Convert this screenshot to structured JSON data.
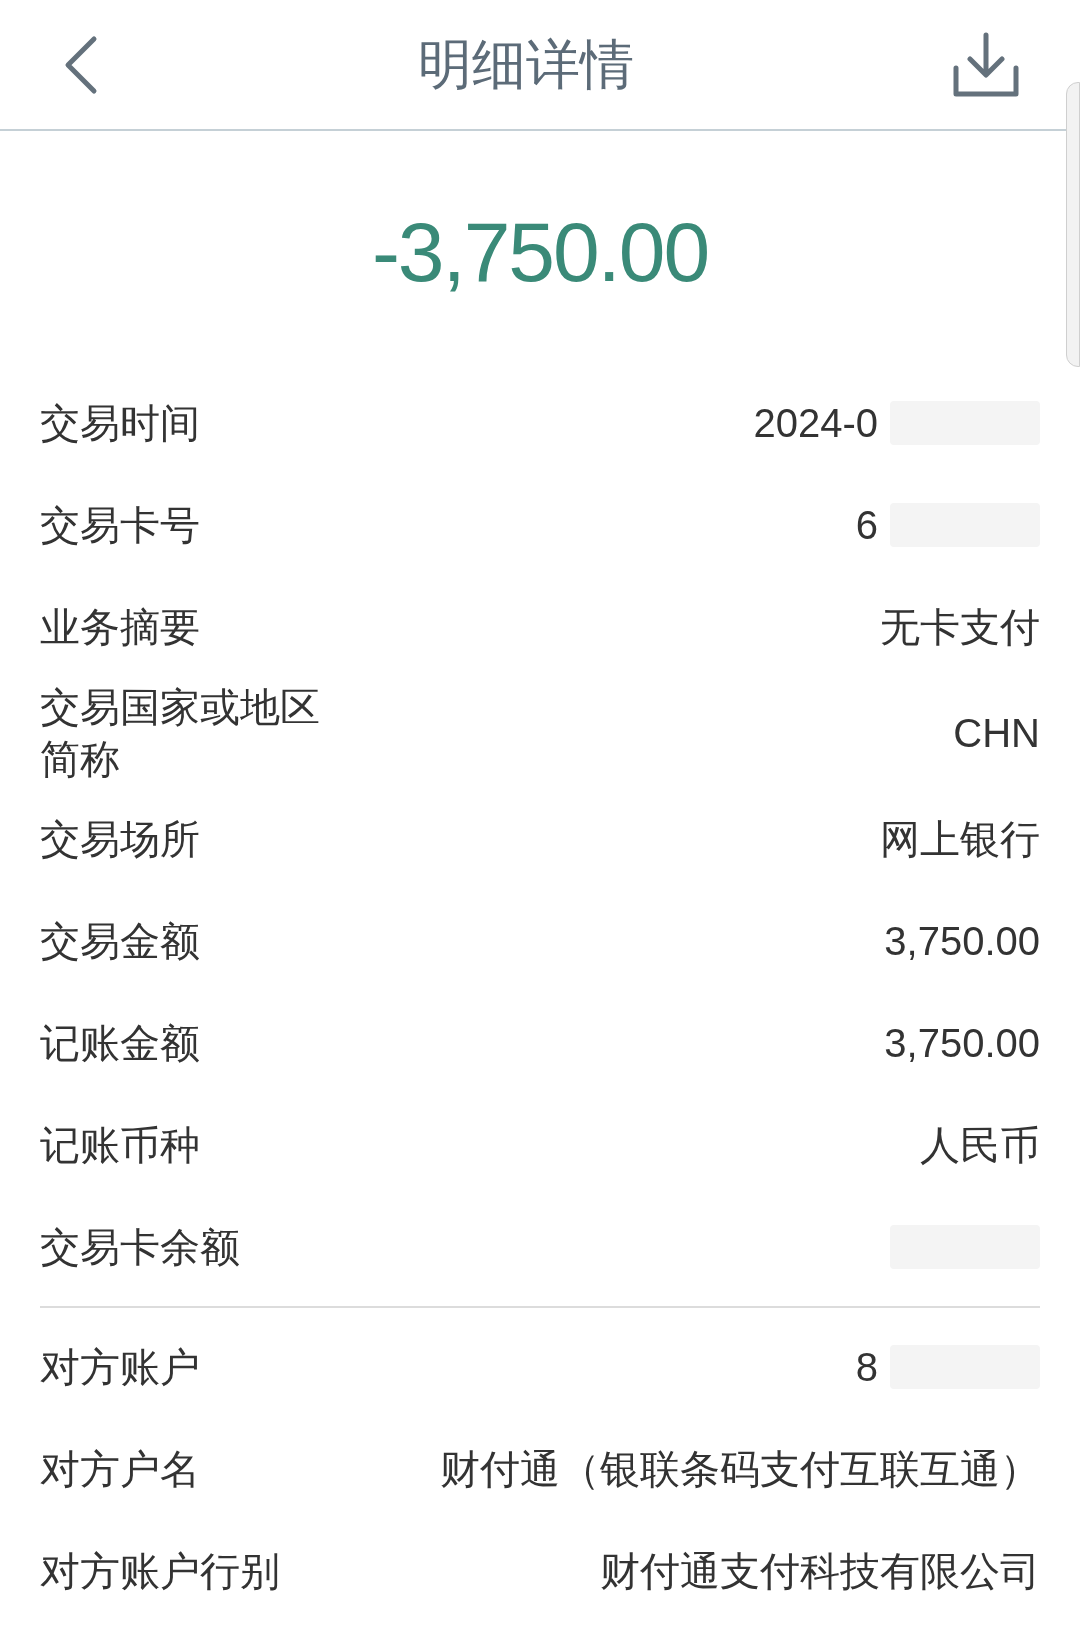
{
  "header": {
    "title": "明细详情"
  },
  "amount": "-3,750.00",
  "details": [
    {
      "label": "交易时间",
      "value": "2024-0",
      "redacted": true
    },
    {
      "label": "交易卡号",
      "value": "6",
      "redacted": true
    },
    {
      "label": "业务摘要",
      "value": "无卡支付",
      "redacted": false
    },
    {
      "label": "交易国家或地区简称",
      "value": "CHN",
      "redacted": false
    },
    {
      "label": "交易场所",
      "value": "网上银行",
      "redacted": false
    },
    {
      "label": "交易金额",
      "value": "3,750.00",
      "redacted": false
    },
    {
      "label": "记账金额",
      "value": "3,750.00",
      "redacted": false
    },
    {
      "label": "记账币种",
      "value": "人民币",
      "redacted": false
    },
    {
      "label": "交易卡余额",
      "redacted": true
    }
  ],
  "counterparty": [
    {
      "label": "对方账户",
      "value": "8",
      "redacted": true
    },
    {
      "label": "对方户名",
      "value": "财付通（银联条码支付互联互通）",
      "redacted": false
    },
    {
      "label": "对方账户行别",
      "value": "财付通支付科技有限公司",
      "redacted": false
    }
  ]
}
